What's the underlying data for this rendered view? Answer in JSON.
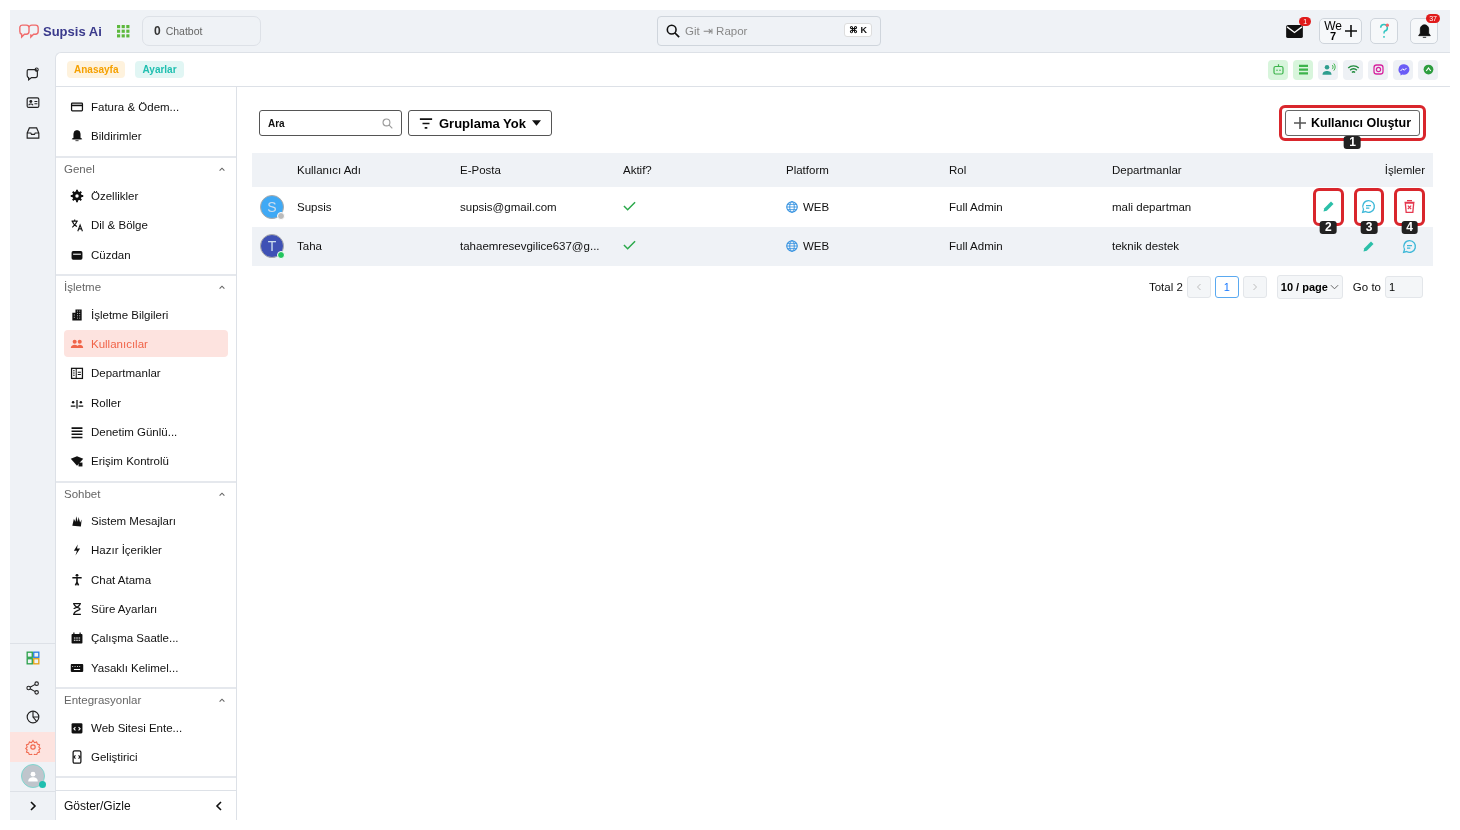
{
  "header": {
    "logo_text": "Supsis Ai",
    "chatbot": {
      "count": "0",
      "label": "Chatbot"
    },
    "search": {
      "placeholder": "Git ⇥ Rapor",
      "shortcut": "⌘ K"
    },
    "mail_badge": "1",
    "we_button": {
      "label": "We",
      "sub": "7"
    },
    "notification_badge": "37"
  },
  "rail_items": [
    {
      "kind": "chat",
      "selected": false
    },
    {
      "kind": "contact",
      "selected": false
    },
    {
      "kind": "inbox",
      "selected": false
    },
    {
      "kind": "apps",
      "selected": false
    },
    {
      "kind": "share",
      "selected": false
    },
    {
      "kind": "report",
      "selected": false
    },
    {
      "kind": "settings",
      "selected": true
    }
  ],
  "breadcrumbs": [
    {
      "label": "Anasayfa",
      "color": "#f5a000"
    },
    {
      "label": "Ayarlar",
      "color": "#1fbfb0"
    }
  ],
  "sidebar": {
    "top_items": [
      {
        "label": "Fatura & Ödem...",
        "selected": false
      },
      {
        "label": "Bildirimler",
        "selected": false
      }
    ],
    "sections": [
      {
        "title": "Genel",
        "expanded": true,
        "items": [
          {
            "label": "Özellikler",
            "selected": false
          },
          {
            "label": "Dil & Bölge",
            "selected": false
          },
          {
            "label": "Cüzdan",
            "selected": false
          }
        ]
      },
      {
        "title": "İşletme",
        "expanded": true,
        "items": [
          {
            "label": "İşletme Bilgileri",
            "selected": false
          },
          {
            "label": "Kullanıcılar",
            "selected": true
          },
          {
            "label": "Departmanlar",
            "selected": false
          },
          {
            "label": "Roller",
            "selected": false
          },
          {
            "label": "Denetim Günlü...",
            "selected": false
          },
          {
            "label": "Erişim Kontrolü",
            "selected": false
          }
        ]
      },
      {
        "title": "Sohbet",
        "expanded": true,
        "items": [
          {
            "label": "Sistem Mesajları",
            "selected": false
          },
          {
            "label": "Hazır İçerikler",
            "selected": false
          },
          {
            "label": "Chat Atama",
            "selected": false
          },
          {
            "label": "Süre Ayarları",
            "selected": false
          },
          {
            "label": "Çalışma Saatle...",
            "selected": false
          },
          {
            "label": "Yasaklı Kelimel...",
            "selected": false
          }
        ]
      },
      {
        "title": "Entegrasyonlar",
        "expanded": true,
        "items": [
          {
            "label": "Web Sitesi Ente...",
            "selected": false
          },
          {
            "label": "Geliştirici",
            "selected": false
          }
        ]
      }
    ],
    "footer_toggle": "Göster/Gizle"
  },
  "toolbar": {
    "search": {
      "placeholder": "Ara"
    },
    "grouping": "Gruplama Yok",
    "create_button": {
      "label": "Kullanıcı Oluştur",
      "callout": "1"
    }
  },
  "table": {
    "columns": [
      "Kullanıcı Adı",
      "E-Posta",
      "Aktif?",
      "Platform",
      "Rol",
      "Departmanlar",
      "İşlemler"
    ],
    "rows": [
      {
        "initial": "S",
        "color": "#3fa9f5",
        "online": false,
        "username": "Supsis",
        "email": "supsis@gmail.com",
        "active": true,
        "platform": "WEB",
        "role": "Full Admin",
        "department": "mali departman",
        "actions": [
          {
            "kind": "edit",
            "callout": "2"
          },
          {
            "kind": "chat",
            "callout": "3"
          },
          {
            "kind": "delete",
            "callout": "4"
          }
        ]
      },
      {
        "initial": "T",
        "color": "#3f51b5",
        "online": true,
        "username": "Taha",
        "email": "tahaemresevgilice637@g...",
        "active": true,
        "platform": "WEB",
        "role": "Full Admin",
        "department": "teknik destek",
        "actions": [
          {
            "kind": "edit"
          },
          {
            "kind": "chat"
          }
        ]
      }
    ]
  },
  "pagination": {
    "total": "Total 2",
    "pages": [
      {
        "label": "1",
        "selected": true
      }
    ],
    "page_size": "10 / page",
    "goto_label": "Go to",
    "goto_value": "1"
  }
}
